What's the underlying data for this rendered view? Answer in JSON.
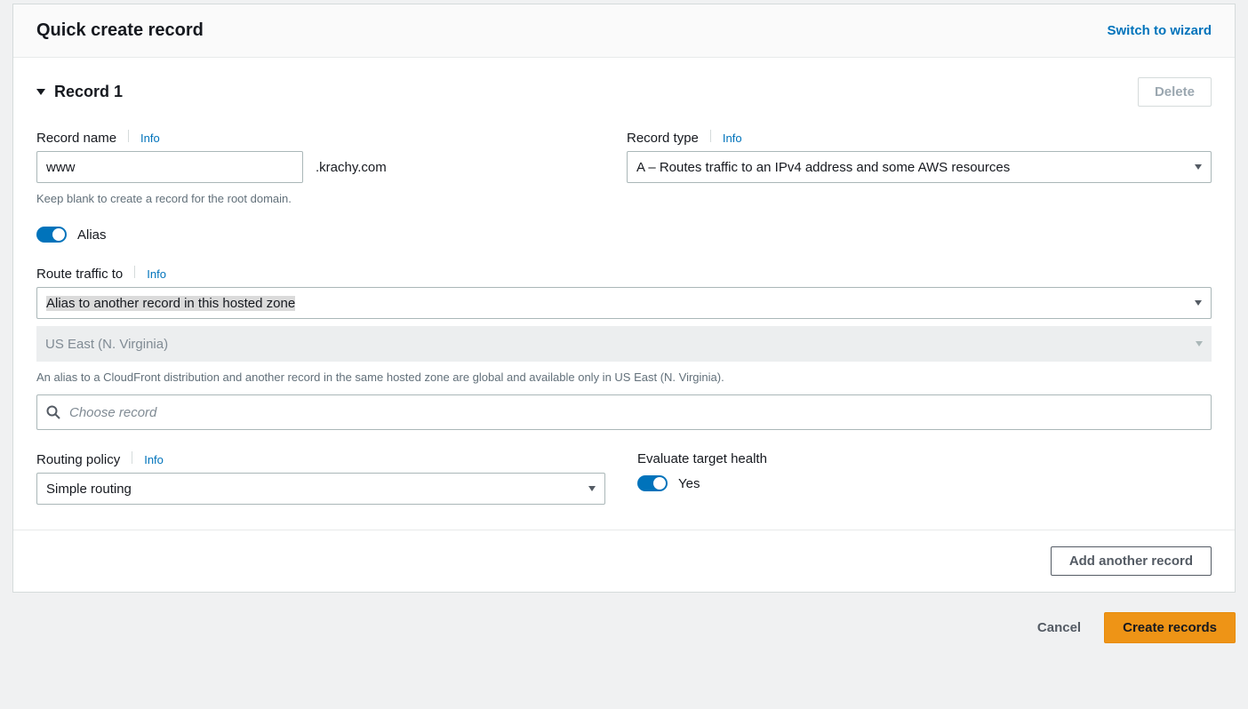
{
  "header": {
    "title": "Quick create record",
    "switch_link": "Switch to wizard"
  },
  "record": {
    "title": "Record 1",
    "delete_label": "Delete",
    "name": {
      "label": "Record name",
      "info": "Info",
      "value": "www",
      "suffix": ".krachy.com",
      "hint": "Keep blank to create a record for the root domain."
    },
    "type": {
      "label": "Record type",
      "info": "Info",
      "value": "A – Routes traffic to an IPv4 address and some AWS resources"
    },
    "alias": {
      "label": "Alias"
    },
    "route_to": {
      "label": "Route traffic to",
      "info": "Info",
      "alias_target": "Alias to another record in this hosted zone",
      "region": "US East (N. Virginia)",
      "region_hint": "An alias to a CloudFront distribution and another record in the same hosted zone are global and available only in US East (N. Virginia).",
      "choose_placeholder": "Choose record"
    },
    "routing_policy": {
      "label": "Routing policy",
      "info": "Info",
      "value": "Simple routing"
    },
    "eval_health": {
      "label": "Evaluate target health",
      "value": "Yes"
    }
  },
  "footer": {
    "add_another": "Add another record",
    "cancel": "Cancel",
    "create": "Create records"
  }
}
